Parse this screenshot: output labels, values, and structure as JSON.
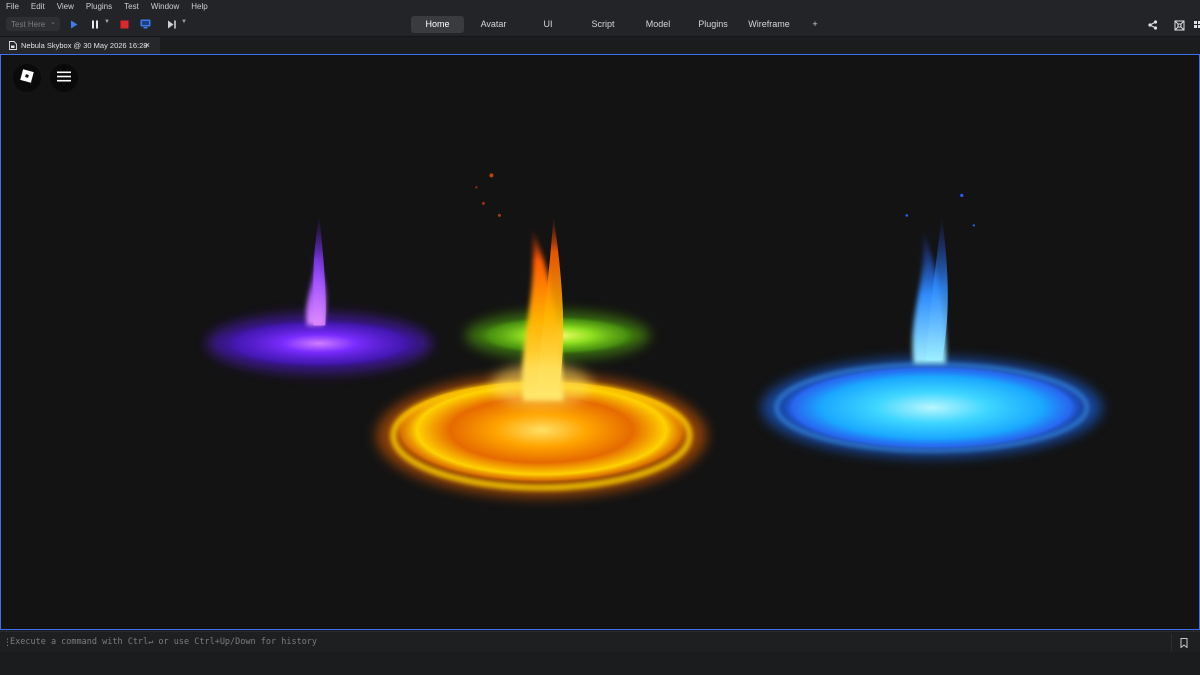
{
  "menubar": {
    "items": [
      "File",
      "Edit",
      "View",
      "Plugins",
      "Test",
      "Window",
      "Help"
    ]
  },
  "toolbar": {
    "test_mode": "Test Here",
    "tabs": [
      "Home",
      "Avatar",
      "UI",
      "Script",
      "Model",
      "Plugins",
      "Wireframe",
      "+"
    ],
    "active_tab": "Home",
    "icons": {
      "play": "play-icon",
      "pause": "pause-icon",
      "stop": "stop-icon",
      "screen": "screen-icon",
      "step": "step-forward-icon",
      "share": "share-icon",
      "collaborate": "collaborate-icon",
      "grid": "grid-icon"
    },
    "colors": {
      "play": "#3d7bf0",
      "stop": "#e0262a",
      "screen": "#3d7bf0"
    }
  },
  "document": {
    "tab_title": "Nebula Skybox @ 30 May 2026 16:28",
    "close_glyph": "×"
  },
  "viewport": {
    "border_color": "#3f6ff2",
    "background": "#131313",
    "overlay_buttons": [
      "roblox-logo-icon",
      "hamburger-menu-icon"
    ],
    "effects": [
      {
        "name": "purple",
        "color": "#7a2cff"
      },
      {
        "name": "green",
        "color": "#7fdc1a"
      },
      {
        "name": "orange",
        "color": "#ff9a00"
      },
      {
        "name": "blue",
        "color": "#1aa8ff"
      }
    ]
  },
  "command_bar": {
    "placeholder": "Execute a command with Ctrl↵ or use Ctrl+Up/Down for history",
    "bookmark_icon": "bookmark-icon"
  }
}
